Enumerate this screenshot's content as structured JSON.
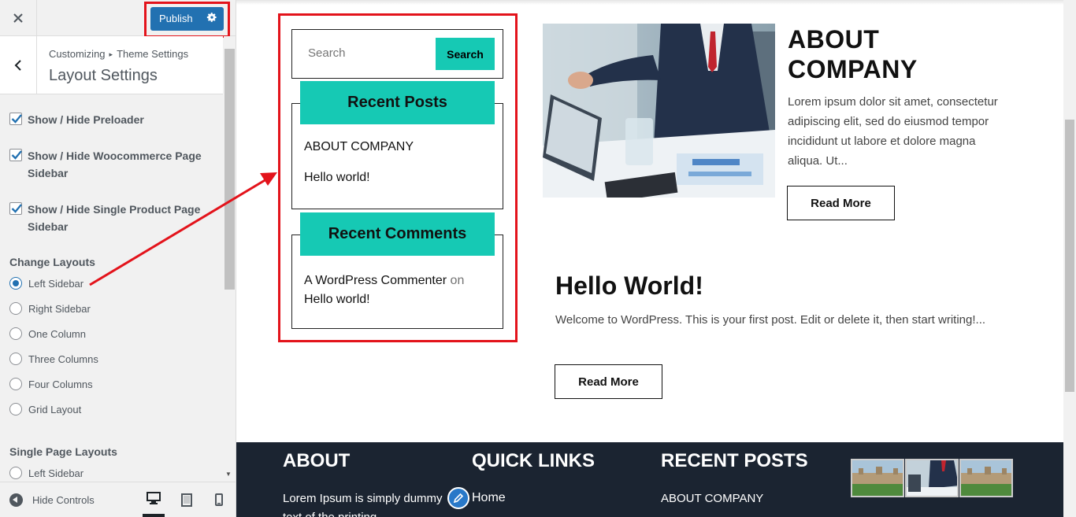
{
  "customizer": {
    "publish_label": "Publish",
    "breadcrumb_root": "Customizing",
    "breadcrumb_parent": "Theme Settings",
    "section_title": "Layout Settings",
    "checkboxes": [
      {
        "label": "Show / Hide Preloader",
        "checked": true
      },
      {
        "label": "Show / Hide Woocommerce Page Sidebar",
        "checked": true
      },
      {
        "label": "Show / Hide Single Product Page Sidebar",
        "checked": true
      }
    ],
    "change_layouts": {
      "title": "Change Layouts",
      "selected": "Left Sidebar",
      "options": [
        "Left Sidebar",
        "Right Sidebar",
        "One Column",
        "Three Columns",
        "Four Columns",
        "Grid Layout"
      ]
    },
    "single_page_layouts": {
      "title": "Single Page Layouts",
      "options": [
        "Left Sidebar"
      ]
    },
    "hide_controls_label": "Hide Controls",
    "devices": [
      "desktop-icon",
      "tablet-icon",
      "mobile-icon"
    ],
    "active_device": "desktop"
  },
  "preview": {
    "sidebar": {
      "search_placeholder": "Search",
      "search_button": "Search",
      "recent_posts_title": "Recent Posts",
      "recent_posts": [
        "ABOUT COMPANY",
        "Hello world!"
      ],
      "recent_comments_title": "Recent Comments",
      "comment_author": "A WordPress Commenter",
      "comment_on": "on",
      "comment_post": "Hello world!"
    },
    "posts": [
      {
        "title": "ABOUT COMPANY",
        "excerpt": "Lorem ipsum dolor sit amet, consectetur adipiscing elit, sed do eiusmod tempor incididunt ut labore et dolore magna aliqua. Ut...",
        "read_more": "Read More"
      },
      {
        "title": "Hello World!",
        "excerpt": "Welcome to WordPress. This is your first post. Edit or delete it, then start writing!...",
        "read_more": "Read More"
      }
    ],
    "footer": {
      "about_title": "ABOUT",
      "about_text": "Lorem Ipsum is simply dummy text of the printing",
      "quick_links_title": "QUICK LINKS",
      "quick_links": [
        "Home"
      ],
      "recent_posts_title": "RECENT POSTS",
      "recent_posts": [
        "ABOUT COMPANY"
      ]
    }
  },
  "colors": {
    "accent": "#16c9b4",
    "publish": "#2271b1",
    "annotation": "#e3131b",
    "footer_bg": "#1b2431"
  }
}
